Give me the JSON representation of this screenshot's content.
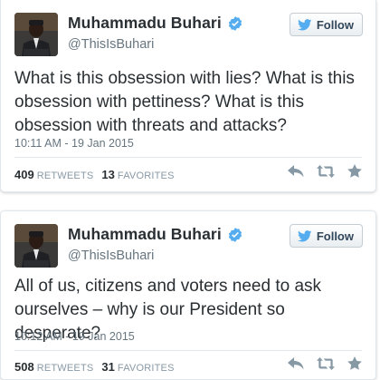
{
  "tweets": [
    {
      "name": "Muhammadu Buhari",
      "handle": "@ThisIsBuhari",
      "follow_label": "Follow",
      "text": "What is this obsession with lies? What is this obsession with pettiness? What is this obsession with threats and attacks?",
      "timestamp": "10:11 AM - 19 Jan 2015",
      "retweets": "409",
      "retweets_label": "RETWEETS",
      "favorites": "13",
      "favorites_label": "FAVORITES"
    },
    {
      "name": "Muhammadu Buhari",
      "handle": "@ThisIsBuhari",
      "follow_label": "Follow",
      "text": "All of us, citizens and voters need to ask ourselves – why is our President so desperate?",
      "timestamp": "10:12 AM - 19 Jan 2015",
      "retweets": "508",
      "retweets_label": "RETWEETS",
      "favorites": "31",
      "favorites_label": "FAVORITES"
    }
  ],
  "icons": {
    "verified": "verified-badge-icon",
    "follow": "twitter-bird-icon",
    "reply": "reply-icon",
    "retweet": "retweet-icon",
    "favorite": "star-icon"
  },
  "colors": {
    "verified": "#55acee",
    "twitter_bird": "#55acee",
    "action_icons": "#8899a6",
    "text": "#292f33",
    "muted": "#66757f"
  }
}
